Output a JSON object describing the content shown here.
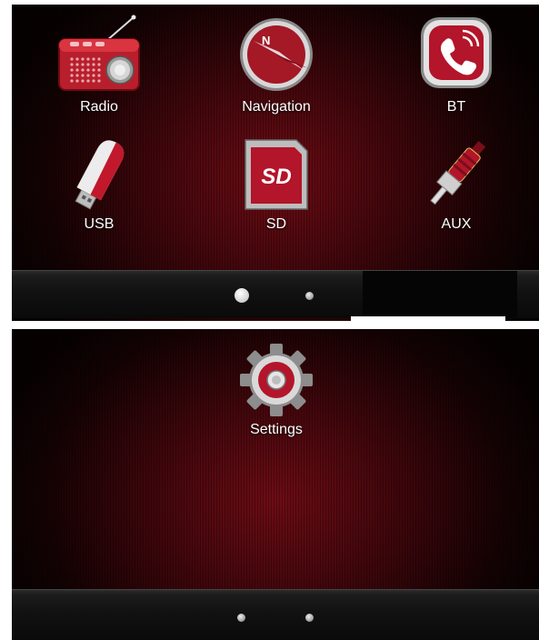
{
  "screen1": {
    "apps": [
      {
        "id": "radio",
        "label": "Radio",
        "icon": "radio-icon"
      },
      {
        "id": "navigation",
        "label": "Navigation",
        "icon": "compass-icon"
      },
      {
        "id": "bt",
        "label": "BT",
        "icon": "phone-icon"
      },
      {
        "id": "usb",
        "label": "USB",
        "icon": "usb-drive-icon"
      },
      {
        "id": "sd",
        "label": "SD",
        "icon": "sd-card-icon"
      },
      {
        "id": "aux",
        "label": "AUX",
        "icon": "rca-plug-icon"
      }
    ],
    "pager": {
      "pages": 2,
      "current": 1
    }
  },
  "screen2": {
    "apps": [
      {
        "id": "settings",
        "label": "Settings",
        "icon": "gear-icon"
      }
    ],
    "pager": {
      "pages": 2,
      "current": 0
    }
  },
  "icon_texts": {
    "compass_north": "N",
    "sd_logo": "SD"
  },
  "colors": {
    "accent": "#b3152a",
    "background_dark": "#1a0205",
    "label": "#ffffff"
  }
}
